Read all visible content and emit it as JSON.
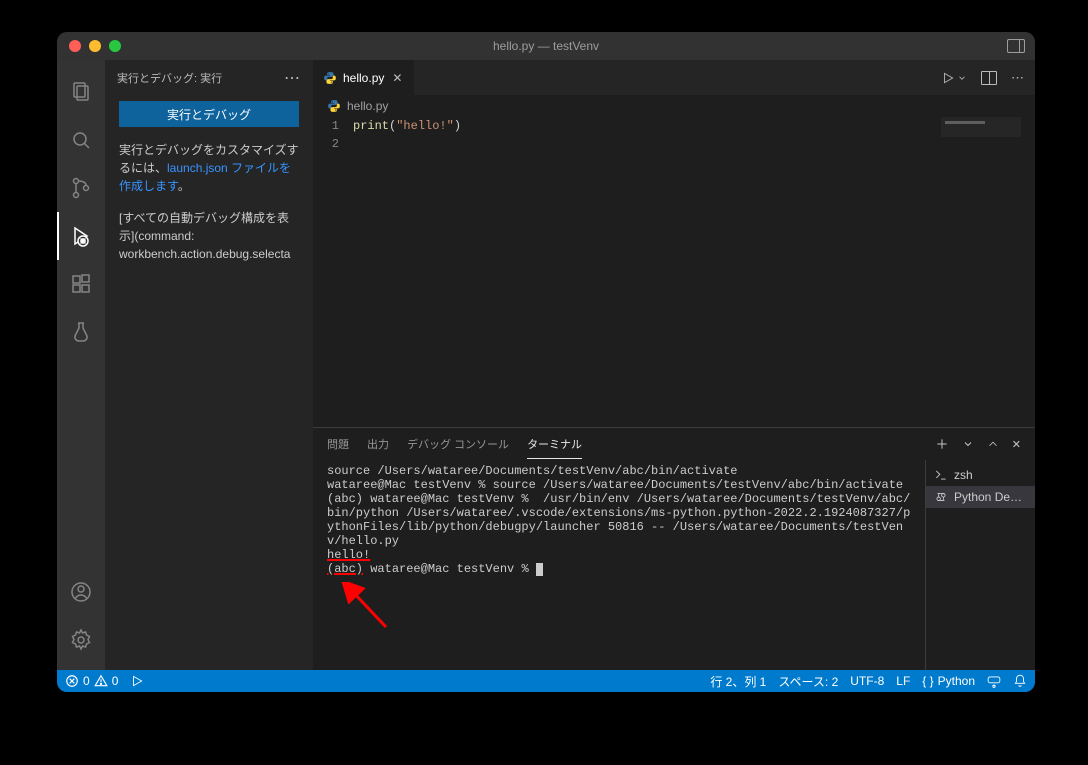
{
  "window": {
    "title": "hello.py — testVenv"
  },
  "sidebar": {
    "header": "実行とデバッグ: 実行",
    "button": "実行とデバッグ",
    "customize_pre": "実行とデバッグをカスタマイズするには、",
    "customize_link": "launch.json ファイルを作成します",
    "customize_post": "。",
    "show_all": "[すべての自動デバッグ構成を表示](command: workbench.action.debug.selecta"
  },
  "tab": {
    "filename": "hello.py"
  },
  "breadcrumb": {
    "filename": "hello.py"
  },
  "editor": {
    "line1_fn": "print",
    "line1_open": "(",
    "line1_str": "\"hello!\"",
    "line1_close": ")",
    "line_numbers": [
      "1",
      "2"
    ]
  },
  "panel_tabs": {
    "problems": "問題",
    "output": "出力",
    "debug_console": "デバッグ コンソール",
    "terminal": "ターミナル"
  },
  "terminal": {
    "line1": "source /Users/wataree/Documents/testVenv/abc/bin/activate",
    "line2": "wataree@Mac testVenv % source /Users/wataree/Documents/testVenv/abc/bin/activate",
    "line3": "(abc) wataree@Mac testVenv %  /usr/bin/env /Users/wataree/Documents/testVenv/abc/bin/python /Users/wataree/.vscode/extensions/ms-python.python-2022.2.1924087327/pythonFiles/lib/python/debugpy/launcher 50816 -- /Users/wataree/Documents/testVenv/hello.py",
    "line4_hello": "hello!",
    "line5_env": "(abc)",
    "line5_rest": " wataree@Mac testVenv % "
  },
  "terminal_list": {
    "zsh": "zsh",
    "python": "Python De…"
  },
  "statusbar": {
    "errors": "0",
    "warnings": "0",
    "line_col": "行 2、列 1",
    "spaces": "スペース: 2",
    "encoding": "UTF-8",
    "eol": "LF",
    "language": "Python"
  }
}
